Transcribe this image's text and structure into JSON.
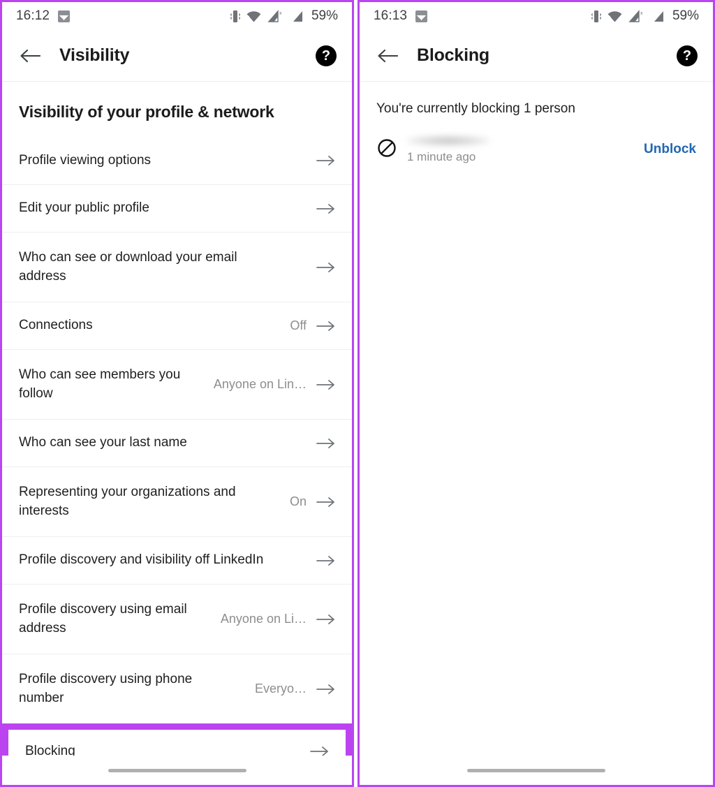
{
  "left_phone": {
    "status_bar": {
      "time": "16:12",
      "battery": "59%",
      "icons": [
        "image-icon",
        "vibrate-icon",
        "wifi-icon",
        "signal-no-sim-icon",
        "signal-icon"
      ]
    },
    "app_bar": {
      "back_label": "back-arrow",
      "title": "Visibility",
      "help_label": "?"
    },
    "section_title": "Visibility of your profile & network",
    "rows": [
      {
        "label": "Profile viewing options",
        "value": ""
      },
      {
        "label": "Edit your public profile",
        "value": ""
      },
      {
        "label": "Who can see or download your email address",
        "value": ""
      },
      {
        "label": "Connections",
        "value": "Off"
      },
      {
        "label": "Who can see members you follow",
        "value": "Anyone on Lin…"
      },
      {
        "label": "Who can see your last name",
        "value": ""
      },
      {
        "label": "Representing your organizations and interests",
        "value": "On"
      },
      {
        "label": "Profile discovery and visibility off LinkedIn",
        "value": ""
      },
      {
        "label": "Profile discovery using email address",
        "value": "Anyone on Li…"
      },
      {
        "label": "Profile discovery using phone number",
        "value": "Everyo…"
      }
    ],
    "highlighted_row": {
      "label": "Blocking",
      "value": ""
    }
  },
  "right_phone": {
    "status_bar": {
      "time": "16:13",
      "battery": "59%",
      "icons": [
        "image-icon",
        "vibrate-icon",
        "wifi-icon",
        "signal-no-sim-icon",
        "signal-icon"
      ]
    },
    "app_bar": {
      "back_label": "back-arrow",
      "title": "Blocking",
      "help_label": "?"
    },
    "blocking_note": "You're currently blocking 1 person",
    "blocked_person": {
      "name": "",
      "time": "1 minute ago",
      "action_label": "Unblock"
    }
  },
  "colors": {
    "highlight_purple": "#bb44f0",
    "link_blue": "#2267b1",
    "text_primary": "#1f1f1f",
    "text_secondary": "#8d8d8d",
    "divider": "#eeeeee",
    "gray_band": "#e9e6e2"
  }
}
